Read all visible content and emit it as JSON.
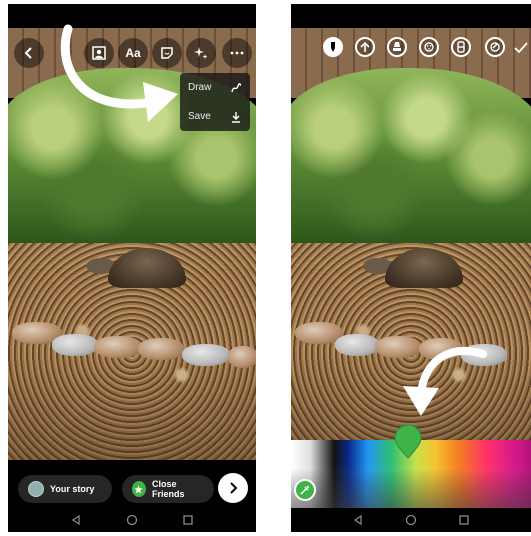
{
  "left_screen": {
    "top_bar": {
      "back": "back",
      "text_label": "Aa"
    },
    "menu": {
      "items": [
        {
          "label": "Draw",
          "icon": "squiggle-icon"
        },
        {
          "label": "Save",
          "icon": "download-icon"
        }
      ]
    },
    "share_bar": {
      "your_story": "Your story",
      "close_friends": "Close Friends"
    }
  },
  "right_screen": {
    "tools": [
      "marker-pen-icon",
      "arrow-pen-icon",
      "highlighter-icon",
      "neon-pen-icon",
      "eraser-icon",
      "brush-size-icon"
    ],
    "colors": {
      "selected": "#3fb24a"
    }
  },
  "colors": {
    "close_friends_green": "#3fb24a",
    "your_story_avatar": "#8fb0b0"
  }
}
